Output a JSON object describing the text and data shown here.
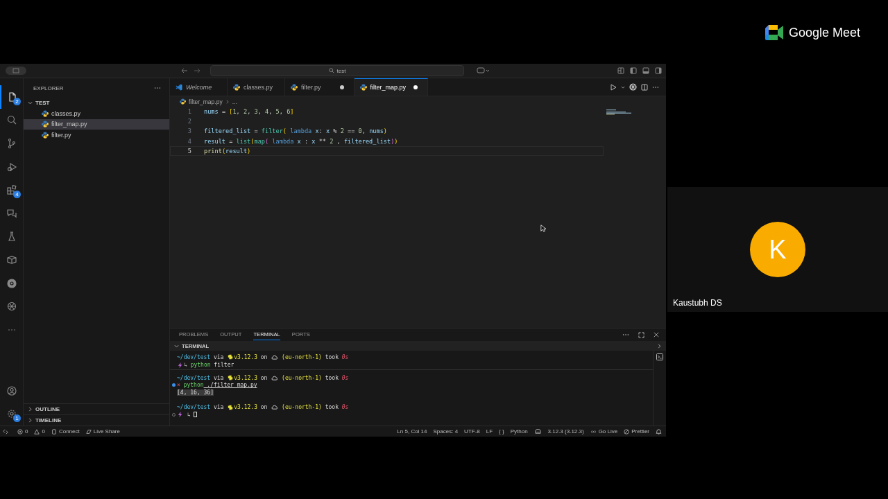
{
  "meet": {
    "brand": "Google Meet",
    "participant": {
      "initial": "K",
      "name": "Kaustubh DS"
    }
  },
  "editor_window": {
    "title_bar": {
      "search": "test"
    },
    "activity_bar": [
      {
        "kind": "files",
        "selected": true,
        "badge": "2"
      },
      {
        "kind": "search",
        "selected": false
      },
      {
        "kind": "branch",
        "selected": false
      },
      {
        "kind": "debug",
        "selected": false
      },
      {
        "kind": "extensions",
        "selected": false,
        "badge": "4"
      },
      {
        "kind": "chat",
        "selected": false
      },
      {
        "kind": "flask",
        "selected": false
      },
      {
        "kind": "box",
        "selected": false
      },
      {
        "kind": "wheel",
        "selected": false
      },
      {
        "kind": "knot",
        "selected": false
      },
      {
        "kind": "more",
        "selected": false
      }
    ],
    "activity_bottom": [
      {
        "kind": "account"
      },
      {
        "kind": "settings",
        "badge": "1"
      }
    ],
    "sidebar": {
      "title": "EXPLORER",
      "folder": {
        "name": "TEST",
        "expanded": true,
        "files": [
          {
            "name": "classes.py",
            "selected": false
          },
          {
            "name": "filter_map.py",
            "selected": true
          },
          {
            "name": "filter.py",
            "selected": false
          }
        ]
      },
      "sections": [
        {
          "name": "OUTLINE",
          "expanded": false
        },
        {
          "name": "TIMELINE",
          "expanded": false
        }
      ]
    },
    "tabs": [
      {
        "label": "Welcome",
        "kind": "welcome",
        "preview": true,
        "selected": false,
        "modified": false
      },
      {
        "label": "classes.py",
        "kind": "python",
        "preview": false,
        "selected": false,
        "modified": false
      },
      {
        "label": "filter.py",
        "kind": "python",
        "preview": false,
        "selected": false,
        "modified": true
      },
      {
        "label": "filter_map.py",
        "kind": "python",
        "preview": false,
        "selected": true,
        "modified": true
      }
    ],
    "breadcrumb": [
      "filter_map.py",
      "..."
    ],
    "code": [
      {
        "number": "1",
        "active": false,
        "tokens": [
          {
            "text": "nums",
            "kind": "var"
          },
          {
            "text": " = ",
            "kind": "op"
          },
          {
            "text": "[",
            "kind": "br1"
          },
          {
            "text": "1",
            "kind": "num"
          },
          {
            "text": ", ",
            "kind": "op"
          },
          {
            "text": "2",
            "kind": "num"
          },
          {
            "text": ", ",
            "kind": "op"
          },
          {
            "text": "3",
            "kind": "num"
          },
          {
            "text": ", ",
            "kind": "op"
          },
          {
            "text": "4",
            "kind": "num"
          },
          {
            "text": ", ",
            "kind": "op"
          },
          {
            "text": "5",
            "kind": "num"
          },
          {
            "text": ", ",
            "kind": "op"
          },
          {
            "text": "6",
            "kind": "num"
          },
          {
            "text": "]",
            "kind": "br1"
          }
        ]
      },
      {
        "number": "2",
        "active": false
      },
      {
        "number": "3",
        "active": false,
        "tokens": [
          {
            "text": "filtered_list",
            "kind": "var"
          },
          {
            "text": " = ",
            "kind": "op"
          },
          {
            "text": "filter",
            "kind": "cls"
          },
          {
            "text": "(",
            "kind": "br1"
          },
          {
            "text": " lambda",
            "kind": "kw"
          },
          {
            "text": " x",
            "kind": "var"
          },
          {
            "text": ": ",
            "kind": "op"
          },
          {
            "text": "x",
            "kind": "var"
          },
          {
            "text": " % ",
            "kind": "op"
          },
          {
            "text": "2",
            "kind": "num"
          },
          {
            "text": " == ",
            "kind": "op"
          },
          {
            "text": "0",
            "kind": "num"
          },
          {
            "text": ", ",
            "kind": "op"
          },
          {
            "text": "nums",
            "kind": "var"
          },
          {
            "text": ")",
            "kind": "br1"
          }
        ]
      },
      {
        "number": "4",
        "active": false,
        "tokens": [
          {
            "text": "result",
            "kind": "var"
          },
          {
            "text": " = ",
            "kind": "op"
          },
          {
            "text": "list",
            "kind": "cls"
          },
          {
            "text": "(",
            "kind": "br1"
          },
          {
            "text": "map",
            "kind": "cls"
          },
          {
            "text": "(",
            "kind": "br2"
          },
          {
            "text": " lambda",
            "kind": "kw"
          },
          {
            "text": " x",
            "kind": "var"
          },
          {
            "text": " : ",
            "kind": "op"
          },
          {
            "text": "x",
            "kind": "var"
          },
          {
            "text": " ** ",
            "kind": "op"
          },
          {
            "text": "2",
            "kind": "num"
          },
          {
            "text": " , ",
            "kind": "op"
          },
          {
            "text": "filtered_list",
            "kind": "var"
          },
          {
            "text": ")",
            "kind": "br2"
          },
          {
            "text": ")",
            "kind": "br1"
          }
        ]
      },
      {
        "number": "5",
        "active": true,
        "tokens": [
          {
            "text": "print",
            "kind": "fn"
          },
          {
            "text": "(",
            "kind": "br1"
          },
          {
            "text": "result",
            "kind": "var"
          },
          {
            "text": ")",
            "kind": "br1"
          }
        ]
      }
    ],
    "panel": {
      "tabs": [
        {
          "label": "PROBLEMS",
          "selected": false
        },
        {
          "label": "OUTPUT",
          "selected": false
        },
        {
          "label": "TERMINAL",
          "selected": true
        },
        {
          "label": "PORTS",
          "selected": false
        }
      ],
      "section": "TERMINAL",
      "lines": [
        {
          "dot": false,
          "divider": false,
          "segments": [
            {
              "text": "~/dev/test",
              "kind": "path"
            },
            {
              "text": " via ",
              "kind": "plain"
            },
            {
              "kind": "py-icon"
            },
            {
              "text": "v3.12.3",
              "kind": "ver"
            },
            {
              "text": " on ",
              "kind": "plain"
            },
            {
              "kind": "cloud-icon"
            },
            {
              "text": " (eu-north-1)",
              "kind": "ver"
            },
            {
              "text": " took ",
              "kind": "plain"
            },
            {
              "text": "0s",
              "kind": "time"
            }
          ]
        },
        {
          "dot": false,
          "divider": true,
          "segments": [
            {
              "kind": "bolt-icon"
            },
            {
              "text": "↳",
              "kind": "arrow"
            },
            {
              "text": " python",
              "kind": "cmd"
            },
            {
              "text": " filter",
              "kind": "plain"
            }
          ]
        },
        {
          "dot": false,
          "divider": false,
          "segments": [
            {
              "text": "~/dev/test",
              "kind": "path"
            },
            {
              "text": " via ",
              "kind": "plain"
            },
            {
              "kind": "py-icon"
            },
            {
              "text": "v3.12.3",
              "kind": "ver"
            },
            {
              "text": " on ",
              "kind": "plain"
            },
            {
              "kind": "cloud-icon"
            },
            {
              "text": " (eu-north-1)",
              "kind": "ver"
            },
            {
              "text": " took ",
              "kind": "plain"
            },
            {
              "text": "0s",
              "kind": "time"
            }
          ]
        },
        {
          "dot": true,
          "done": true,
          "divider": false,
          "segments": [
            {
              "text": "×",
              "kind": "err"
            },
            {
              "text": " python",
              "kind": "cmd"
            },
            {
              "text": " ./filter_map.py",
              "kind": "link"
            }
          ]
        },
        {
          "dot": false,
          "divider": false,
          "segments": [
            {
              "text": "[4, 16, 36]",
              "kind": "output"
            }
          ]
        },
        {
          "dot": false,
          "divider": false,
          "segments": [
            {
              "text": "~/dev/test",
              "kind": "path"
            },
            {
              "text": " via ",
              "kind": "plain"
            },
            {
              "kind": "py-icon"
            },
            {
              "text": "v3.12.3",
              "kind": "ver"
            },
            {
              "text": " on ",
              "kind": "plain"
            },
            {
              "kind": "cloud-icon"
            },
            {
              "text": " (eu-north-1)",
              "kind": "ver"
            },
            {
              "text": " took ",
              "kind": "plain"
            },
            {
              "text": "0s",
              "kind": "time"
            }
          ]
        },
        {
          "dot": true,
          "done": false,
          "divider": false,
          "segments": [
            {
              "kind": "bolt-icon"
            },
            {
              "text": " ↳ ",
              "kind": "arrow"
            },
            {
              "kind": "cursor"
            }
          ]
        }
      ]
    },
    "status_bar": {
      "left": [
        {
          "kind": "remote"
        },
        {
          "kind": "errors",
          "text": "0"
        },
        {
          "kind": "warnings",
          "text": "0"
        },
        {
          "kind": "connect",
          "text": "Connect"
        },
        {
          "kind": "liveshare",
          "text": "Live Share"
        }
      ],
      "right": [
        {
          "kind": "plain",
          "text": "Ln 5, Col 14"
        },
        {
          "kind": "plain",
          "text": "Spaces: 4"
        },
        {
          "kind": "plain",
          "text": "UTF-8"
        },
        {
          "kind": "plain",
          "text": "LF"
        },
        {
          "kind": "plain",
          "text": "{ }"
        },
        {
          "kind": "plain",
          "text": "Python"
        },
        {
          "kind": "copilot"
        },
        {
          "kind": "plain",
          "text": "3.12.3 (3.12.3)"
        },
        {
          "kind": "golive",
          "text": "Go Live"
        },
        {
          "kind": "prettier",
          "text": "Prettier"
        },
        {
          "kind": "bell"
        }
      ]
    }
  }
}
